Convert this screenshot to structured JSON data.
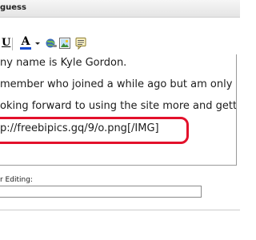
{
  "window": {
    "title": "guess"
  },
  "toolbar": {
    "underline_label": "U",
    "font_color_label": "A",
    "font_color_accent": "#1a4fd1",
    "icons": [
      "underline-icon",
      "font-color-icon",
      "chevron-down-icon",
      "insert-link-icon",
      "insert-image-icon",
      "wrap-quote-icon"
    ]
  },
  "editor": {
    "lines": [
      "ny name is Kyle Gordon.",
      "member who joined a while ago but am only now ge",
      "oking forward to using the site more and getting to",
      "p://freebipics.gq/9/o.png[/IMG]"
    ],
    "highlight_color": "#e3112b"
  },
  "editing": {
    "label": "r Editing:",
    "value": ""
  }
}
